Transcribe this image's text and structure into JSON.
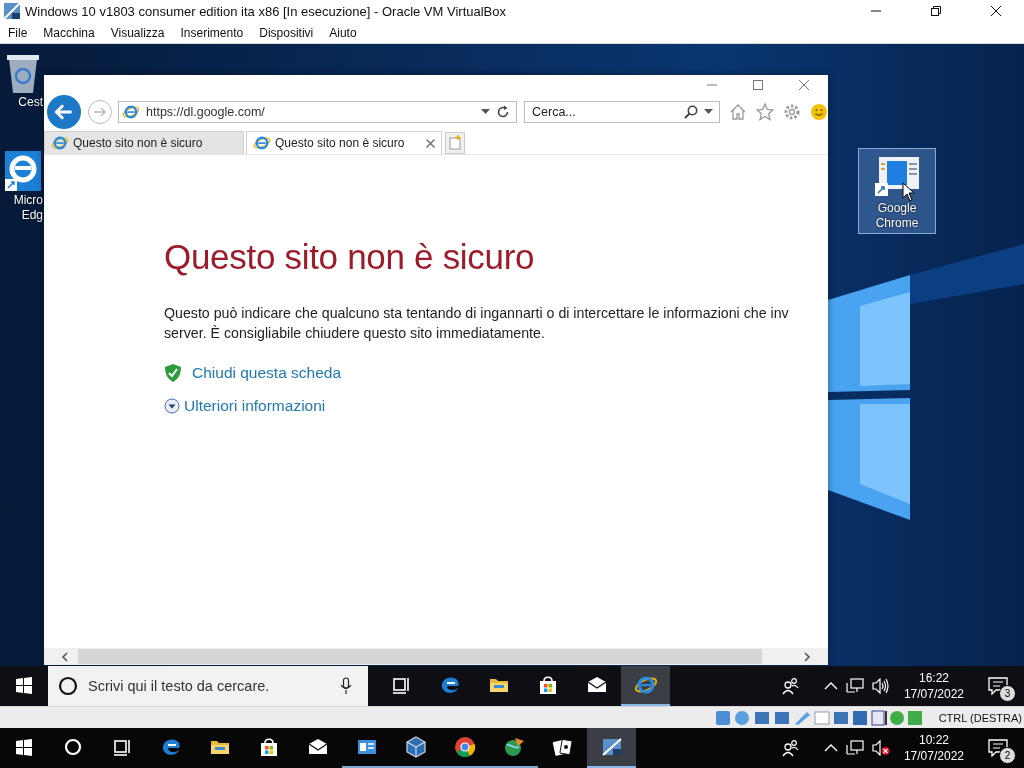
{
  "host_window": {
    "title": "Windows 10 v1803 consumer edition ita x86 [In esecuzione] - Oracle VM VirtualBox"
  },
  "menu": [
    "File",
    "Macchina",
    "Visualizza",
    "Inserimento",
    "Dispositivi",
    "Aiuto"
  ],
  "desktop_icons": [
    {
      "kind": "recycle",
      "lines": [
        "Cest"
      ],
      "selected": false
    },
    {
      "kind": "edge",
      "lines": [
        "Micro",
        "Edg"
      ],
      "selected": false
    },
    {
      "kind": "chrome",
      "lines": [
        "Google",
        "Chrome"
      ],
      "selected": true
    }
  ],
  "browser": {
    "address": "https://dl.google.com/",
    "search_placeholder": "Cerca...",
    "tabs": [
      {
        "title": "Questo sito non è sicuro",
        "selected": false
      },
      {
        "title": "Questo sito non è sicuro",
        "selected": true
      }
    ],
    "page": {
      "heading": "Questo sito non è sicuro",
      "paragraph_lines": [
        "Questo può indicare che qualcuno sta tentando di ingannarti o di intercettare le informazioni che inv",
        "server. È consigliabile chiudere questo sito immediatamente."
      ],
      "links": [
        {
          "kind": "shield",
          "text": "Chiudi questa scheda"
        },
        {
          "kind": "expand",
          "text": "Ulteriori informazioni"
        }
      ]
    }
  },
  "guest_taskbar": {
    "search_placeholder": "Scrivi qui il testo da cercare.",
    "apps": [
      {
        "kind": "taskview",
        "open": false,
        "active": false
      },
      {
        "kind": "edge",
        "open": false,
        "active": false
      },
      {
        "kind": "explorer",
        "open": false,
        "active": false
      },
      {
        "kind": "store",
        "open": false,
        "active": false
      },
      {
        "kind": "mail",
        "open": false,
        "active": false
      },
      {
        "kind": "ie",
        "open": true,
        "active": true
      }
    ],
    "time": "16:22",
    "date": "17/07/2022",
    "notifications": "3",
    "muted": false
  },
  "vbox_status": {
    "host_key": "CTRL (DESTRA)"
  },
  "host_taskbar": {
    "apps": [
      {
        "kind": "cortana",
        "open": false,
        "active": false
      },
      {
        "kind": "taskview",
        "open": false,
        "active": false
      },
      {
        "kind": "edge",
        "open": false,
        "active": false
      },
      {
        "kind": "explorer",
        "open": false,
        "active": false
      },
      {
        "kind": "store",
        "open": false,
        "active": false
      },
      {
        "kind": "mail",
        "open": false,
        "active": false
      },
      {
        "kind": "panel",
        "open": true,
        "active": false
      },
      {
        "kind": "vbox",
        "open": true,
        "active": false
      },
      {
        "kind": "chrome",
        "open": true,
        "active": false
      },
      {
        "kind": "globe",
        "open": true,
        "active": false
      },
      {
        "kind": "cards",
        "open": false,
        "active": false
      },
      {
        "kind": "vm",
        "open": true,
        "active": true
      }
    ],
    "time": "10:22",
    "date": "17/07/2022",
    "notifications": "2",
    "muted": true
  }
}
